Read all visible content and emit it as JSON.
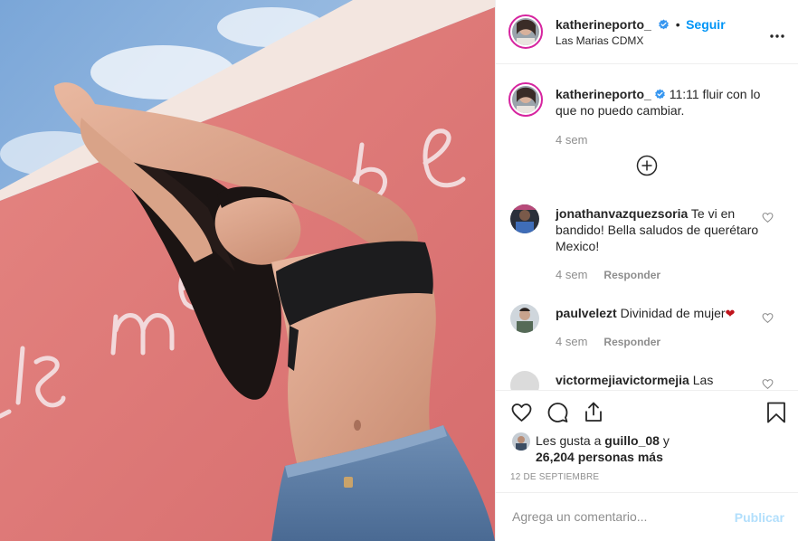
{
  "post": {
    "username": "katherineporto_",
    "separator": "•",
    "follow_label": "Seguir",
    "location": "Las Marias CDMX",
    "more_icon": "more-horizontal-icon",
    "caption": "11:11 fluir con lo que no puedo cambiar.",
    "caption_time": "4 sem",
    "verified_color": "#3897f0"
  },
  "comments": [
    {
      "username": "jonathanvazquezsoria",
      "text": "Te vi en bandido! Bella saludos de querétaro Mexico!",
      "time": "4 sem",
      "reply_label": "Responder"
    },
    {
      "username": "paulvelezt",
      "text": "Divinidad de mujer",
      "emoji": "❤",
      "time": "4 sem",
      "reply_label": "Responder"
    },
    {
      "username": "victormejiavictormejia",
      "text": "Las"
    }
  ],
  "likes": {
    "prefix": "Les gusta a",
    "user": "guillo_08",
    "connector": "y",
    "others": "26,204 personas más"
  },
  "date": "12 DE SEPTIEMBRE",
  "composer": {
    "placeholder": "Agrega un comentario...",
    "publish_label": "Publicar"
  },
  "colors": {
    "accent": "#0095f6",
    "wall": "#e07b7b",
    "sky": "#8fb3da"
  }
}
